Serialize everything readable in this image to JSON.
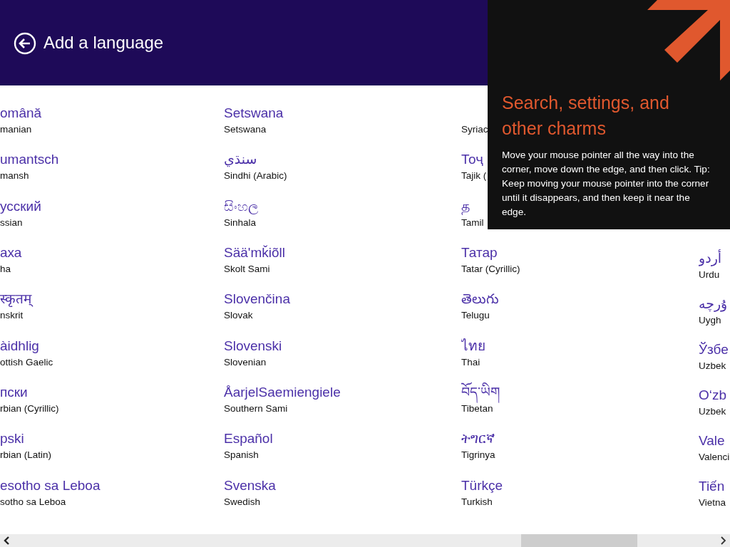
{
  "header": {
    "title": "Add a language"
  },
  "columns": [
    {
      "items": [
        {
          "native": "omână",
          "english": "manian"
        },
        {
          "native": "umantsch",
          "english": "mansh"
        },
        {
          "native": "усский",
          "english": "ssian"
        },
        {
          "native": "аха",
          "english": "ha"
        },
        {
          "native": "स्कृतम्",
          "english": "nskrit"
        },
        {
          "native": "àidhlig",
          "english": "ottish Gaelic"
        },
        {
          "native": "пски",
          "english": "rbian (Cyrillic)"
        },
        {
          "native": "pski",
          "english": "rbian (Latin)"
        },
        {
          "native": "esotho sa Leboa",
          "english": "sotho sa Leboa"
        }
      ]
    },
    {
      "items": [
        {
          "native": "Setswana",
          "english": "Setswana"
        },
        {
          "native": "سنڌي",
          "english": "Sindhi (Arabic)"
        },
        {
          "native": "සිංහල",
          "english": "Sinhala"
        },
        {
          "native": "Sääʹmǩiõll",
          "english": "Skolt Sami"
        },
        {
          "native": "Slovenčina",
          "english": "Slovak"
        },
        {
          "native": "Slovenski",
          "english": "Slovenian"
        },
        {
          "native": "ÅarjelSaemiengiele",
          "english": "Southern Sami"
        },
        {
          "native": "Español",
          "english": "Spanish"
        },
        {
          "native": "Svenska",
          "english": "Swedish"
        }
      ]
    },
    {
      "items": [
        {
          "english": "Syriac"
        },
        {
          "native": "Тоҷ",
          "english": "Tajik ("
        },
        {
          "native": "த",
          "english": "Tamil"
        },
        {
          "native": "Татар",
          "english": "Tatar (Cyrillic)"
        },
        {
          "native": "తెలుగు",
          "english": "Telugu"
        },
        {
          "native": "ไทย",
          "english": "Thai"
        },
        {
          "native": "བོད་ཡིག",
          "english": "Tibetan"
        },
        {
          "native": "ትግርኛ",
          "english": "Tigrinya"
        },
        {
          "native": "Türkçe",
          "english": "Turkish"
        }
      ]
    },
    {
      "items": [
        {
          "native": "أردو",
          "english": "Urdu"
        },
        {
          "native": "ۇرچە",
          "english": "Uygh"
        },
        {
          "native": "Ўзбе",
          "english": "Uzbek"
        },
        {
          "native": "O‘zb",
          "english": "Uzbek"
        },
        {
          "native": "Vale",
          "english": "Valenci"
        },
        {
          "native": "Tiến",
          "english": "Vietna"
        }
      ]
    }
  ],
  "charms_tip": {
    "heading": "Search, settings, and other charms",
    "body": "Move your mouse pointer all the way into the corner, move down the edge, and then click. Tip: Keep moving your mouse pointer into the corner until it disappears, and then keep it near the edge."
  }
}
